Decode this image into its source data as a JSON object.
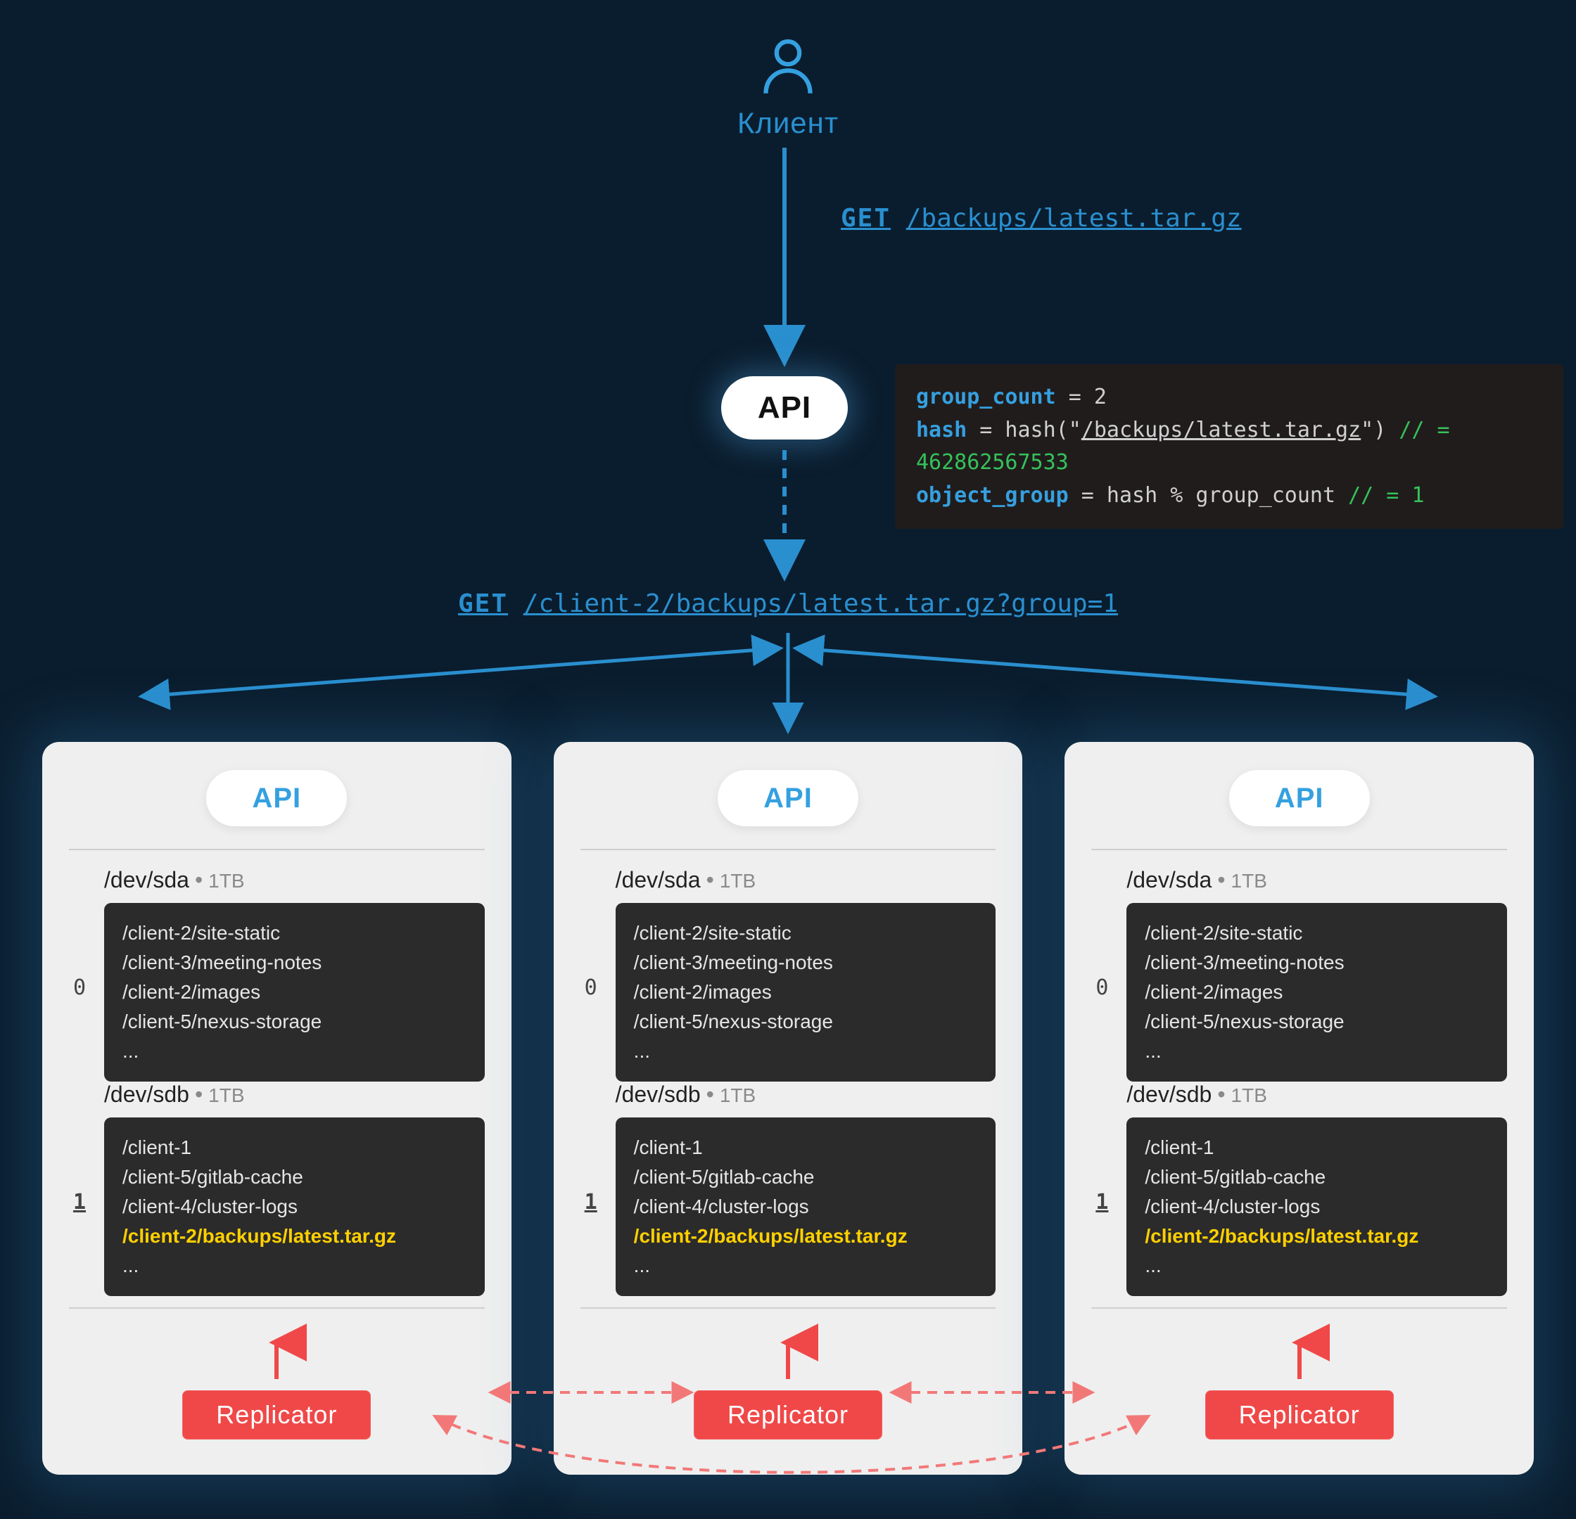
{
  "client_label": "Клиент",
  "request_top": {
    "method": "GET",
    "path": "/backups/latest.tar.gz"
  },
  "gateway_label": "API",
  "code": {
    "group_count_label": "group_count",
    "group_count_expr": " = 2",
    "hash_label": "hash",
    "hash_expr_prefix": " = hash(\"",
    "hash_arg": "/backups/latest.tar.gz",
    "hash_expr_suffix": "\") ",
    "hash_comment": "// = 462862567533",
    "object_group_label": "object_group",
    "object_group_expr": " = hash % group_count  ",
    "object_group_comment": "// = 1"
  },
  "request_second": {
    "method": "GET",
    "path": "/client-2/backups/latest.tar.gz?group=1"
  },
  "server": {
    "api_label": "API",
    "disks": [
      {
        "index": "0",
        "index_under": false,
        "path": "/dev/sda",
        "size": "1TB",
        "entries": [
          "/client-2/site-static",
          "/client-3/meeting-notes",
          "/client-2/images",
          "/client-5/nexus-storage",
          "..."
        ],
        "highlight": null
      },
      {
        "index": "1",
        "index_under": true,
        "path": "/dev/sdb",
        "size": "1TB",
        "entries": [
          "/client-1",
          "/client-5/gitlab-cache",
          "/client-4/cluster-logs",
          "/client-2/backups/latest.tar.gz",
          "..."
        ],
        "highlight": "/client-2/backups/latest.tar.gz"
      }
    ],
    "replicator_label": "Replicator"
  },
  "server_count": 3
}
